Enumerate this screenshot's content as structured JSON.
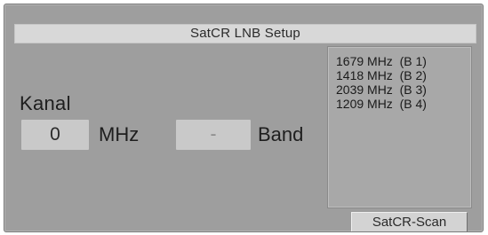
{
  "window": {
    "title": "SatCR LNB Setup"
  },
  "channel": {
    "label": "Kanal",
    "frequency_value": "0",
    "frequency_unit": "MHz",
    "band_value": "-",
    "band_unit": "Band"
  },
  "frequency_list": {
    "items": [
      {
        "text": "1679 MHz  (B 1)"
      },
      {
        "text": "1418 MHz  (B 2)"
      },
      {
        "text": "2039 MHz  (B 3)"
      },
      {
        "text": "1209 MHz  (B 4)"
      }
    ]
  },
  "actions": {
    "scan_label": "SatCR-Scan"
  }
}
